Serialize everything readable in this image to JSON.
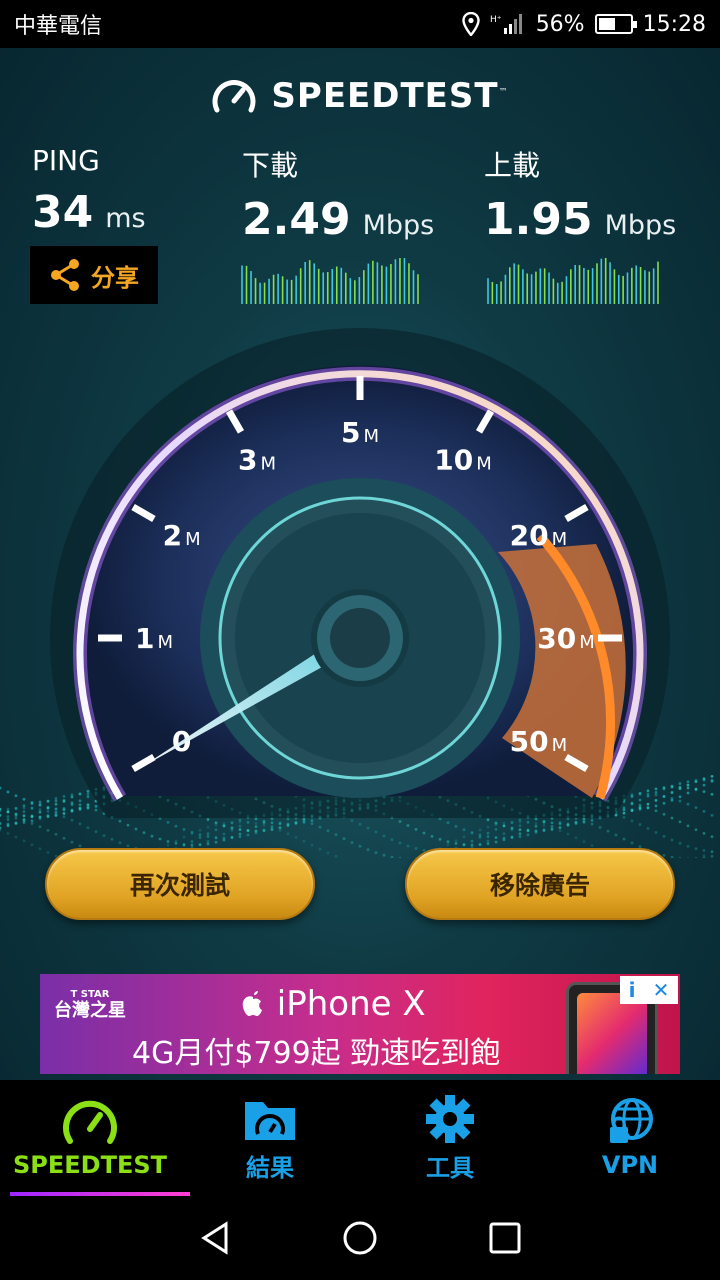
{
  "status_bar": {
    "carrier": "中華電信",
    "battery": "56%",
    "time": "15:28",
    "battery_level": 0.56
  },
  "app": {
    "logo_text": "SPEEDTEST",
    "trademark": "™"
  },
  "metrics": {
    "ping": {
      "label": "PING",
      "value": "34",
      "unit": "ms"
    },
    "download": {
      "label": "下載",
      "value": "2.49",
      "unit": "Mbps"
    },
    "upload": {
      "label": "上載",
      "value": "1.95",
      "unit": "Mbps"
    }
  },
  "share_label": "分享",
  "gauge": {
    "ticks": [
      {
        "num": "0",
        "unit": ""
      },
      {
        "num": "1",
        "unit": "M"
      },
      {
        "num": "2",
        "unit": "M"
      },
      {
        "num": "3",
        "unit": "M"
      },
      {
        "num": "5",
        "unit": "M"
      },
      {
        "num": "10",
        "unit": "M"
      },
      {
        "num": "20",
        "unit": "M"
      },
      {
        "num": "30",
        "unit": "M"
      },
      {
        "num": "50",
        "unit": "M"
      }
    ]
  },
  "buttons": {
    "retest": "再次測試",
    "remove_ads": "移除廣告"
  },
  "ad": {
    "brand_small": "T STAR",
    "brand": "台灣之星",
    "headline": " iPhone X",
    "offer": "4G月付$799起 勁速吃到飽",
    "info": "i",
    "close": "✕"
  },
  "bottom_nav": [
    {
      "label": "SPEEDTEST",
      "icon": "speedometer-icon",
      "active": true
    },
    {
      "label": "結果",
      "icon": "results-folder-icon",
      "active": false
    },
    {
      "label": "工具",
      "icon": "gear-icon",
      "active": false
    },
    {
      "label": "VPN",
      "icon": "globe-lock-icon",
      "active": false
    }
  ],
  "colors": {
    "accent_green": "#8be015",
    "accent_blue": "#19a0e6",
    "button_gold": "#e0a323",
    "share_orange": "#f5a623"
  }
}
